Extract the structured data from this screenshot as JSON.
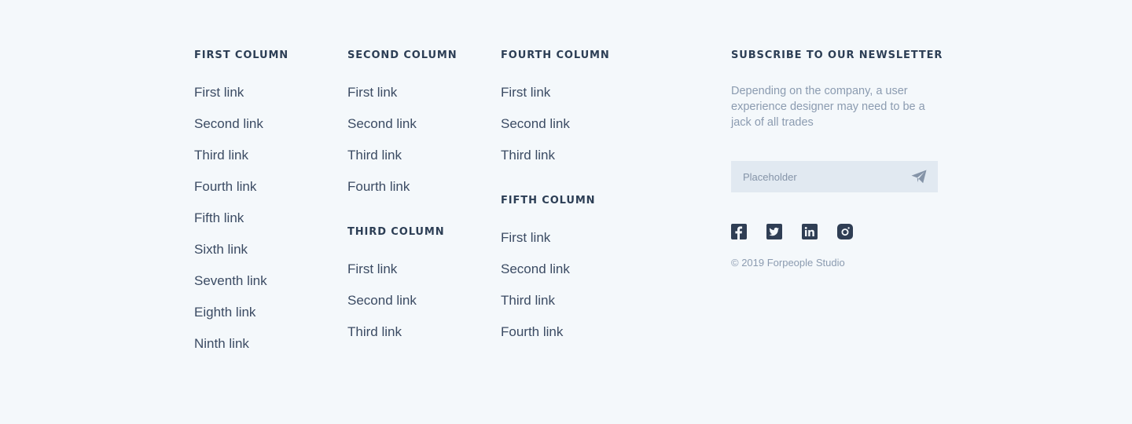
{
  "columns": [
    {
      "heading": "FIRST COLUMN",
      "links": [
        "First link",
        "Second link",
        "Third link",
        "Fourth link",
        "Fifth link",
        "Sixth link",
        "Seventh link",
        "Eighth link",
        "Ninth link"
      ]
    },
    {
      "heading": "SECOND COLUMN",
      "links": [
        "First link",
        "Second link",
        "Third link",
        "Fourth link"
      ]
    },
    {
      "heading": "THIRD COLUMN",
      "links": [
        "First link",
        "Second link",
        "Third link"
      ]
    },
    {
      "heading": "FOURTH COLUMN",
      "links": [
        "First link",
        "Second link",
        "Third link"
      ]
    },
    {
      "heading": "FIFTH COLUMN",
      "links": [
        "First link",
        "Second link",
        "Third link",
        "Fourth link"
      ]
    }
  ],
  "newsletter": {
    "heading": "SUBSCRIBE TO OUR NEWSLETTER",
    "description": "Depending on the company, a user experience designer may need to be a jack of all trades",
    "placeholder": "Placeholder",
    "send_icon": "paper-plane-icon"
  },
  "social": [
    {
      "icon": "facebook-icon"
    },
    {
      "icon": "twitter-icon"
    },
    {
      "icon": "linkedin-icon"
    },
    {
      "icon": "instagram-icon"
    }
  ],
  "copyright": "© 2019 Forpeople Studio",
  "colors": {
    "background": "#f4f8fb",
    "heading": "#2c3e55",
    "link": "#3b4b63",
    "muted": "#8b9bb0",
    "input_bg": "#e1e9f1",
    "icon": "#2f3e54"
  }
}
